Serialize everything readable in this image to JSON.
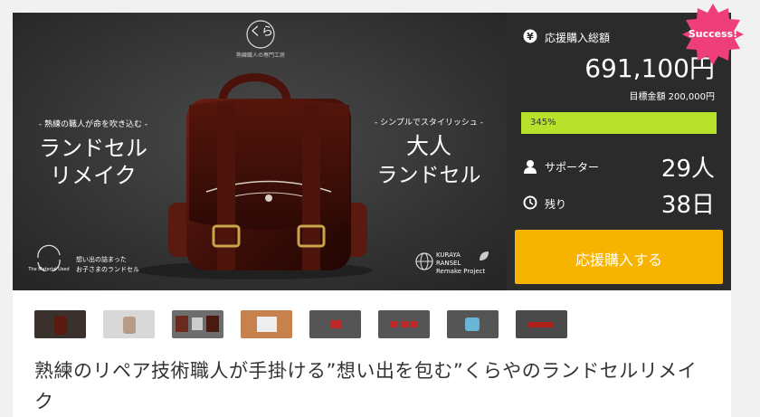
{
  "hero": {
    "logo_mark": "くら",
    "logo_sub": "熟練職人の専門工房",
    "left_subtitle": "- 熟練の職人が命を吹き込む -",
    "left_title_1": "ランドセル",
    "left_title_2": "リメイク",
    "right_subtitle": "- シンプルでスタイリッシュ -",
    "right_title_1": "大人",
    "right_title_2": "ランドセル",
    "bottom_left_logo": "The Material Used",
    "bottom_left_text_1": "想い出の詰まった",
    "bottom_left_text_2": "お子さまのランドセル",
    "project_line_1": "KURAYA",
    "project_line_2": "RANSEL",
    "project_line_3": "Remake Project"
  },
  "side": {
    "success_badge": "Success!",
    "total_label": "応援購入総額",
    "total_value": "691,100円",
    "goal_text": "目標金額 200,000円",
    "progress_label": "345%",
    "progress_fraction": 1.0,
    "supporters_label": "サポーター",
    "supporters_value": "29人",
    "remaining_label": "残り",
    "remaining_value": "38日",
    "cta_label": "応援購入する",
    "colors": {
      "accent_yellow": "#f6b400",
      "progress_green": "#b7e12a",
      "badge_pink": "#ef3f7a",
      "panel_dark": "#2b2b2b"
    }
  },
  "thumbnails": [
    "bag-front-thumb",
    "bag-beige-thumb",
    "bag-collage-thumb",
    "box-thumb",
    "red-parts-thumb",
    "red-blocks-thumb",
    "blue-case-thumb",
    "red-strap-thumb"
  ],
  "project_title": "熟練のリペア技術職人が手掛ける”想い出を包む”くらやのランドセルリメイク"
}
